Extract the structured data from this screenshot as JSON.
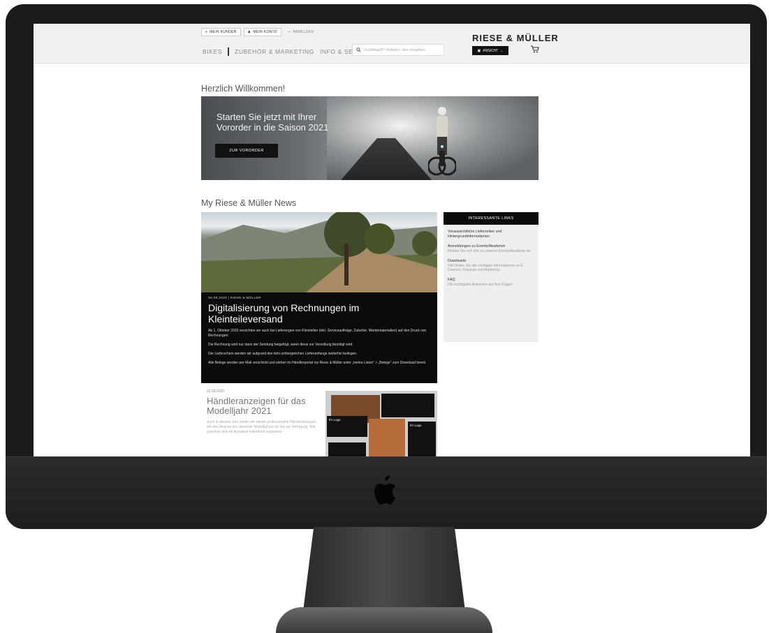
{
  "site": {
    "top_links": [
      "MEIN KUNDEN",
      "MEIN KONTO",
      "ABMELDEN"
    ],
    "brand": "RIESE & MÜLLER",
    "nav": [
      "BIKES",
      "ZUBEHÖR & MARKETING",
      "INFO & SERVICE"
    ],
    "search_placeholder": "Suchbegriff / Artikelnr. hier eingeben",
    "view_label": "ANSICHT",
    "cart_icon": "cart-icon"
  },
  "welcome": "Herzlich Willkommen!",
  "hero": {
    "line1": "Starten Sie jetzt mit Ihrer",
    "line2": "Vororder in die Saison 2021",
    "button": "ZUR VORORDER"
  },
  "news_section_title": "My Riese & Müller News",
  "news": {
    "meta": "30.09.2020 | RIESE & MÜLLER",
    "headline": "Digitalisierung von Rechnungen im Kleinteileversand",
    "p1": "Ab 1. Oktober 2020 verzichten wir auch bei Lieferungen von Kleinteilen (inkl. Serviceaufträge, Zubehör, Werbematerialien) auf den Druck von Rechnungen.",
    "p2": "Die Rechnung wird nur dann der Sendung beigefügt, wenn diese zur Verzollung benötigt wird.",
    "p3": "Der Lieferschein werden wir aufgrund des teils umfangreichen Lieferumfangs weiterhin beilegen.",
    "p4": "Alle Belege werden per Mail verschickt und stehen im Händlerportal my Riese & Müller unter „meine Listen“ > „Belege“ zum Download bereit."
  },
  "links_box": {
    "heading": "INTERESSANTE LINKS",
    "groups": [
      {
        "title": "Voraussichtliche Lieferzeiten und Hintergrundinformationen",
        "desc": ""
      },
      {
        "title": "Anmeldungen zu Events/Akademie",
        "desc": "Melden Sie sich hier zu unseren Events/Akademie an."
      },
      {
        "title": "Downloads",
        "desc": "Hier finden Sie alle wichtigen Informationen zu E-Connect, Kataloge und Marketing."
      },
      {
        "title": "FAQ",
        "desc": "Die wichtigsten Antworten auf Ihre Fragen"
      }
    ]
  },
  "card2": {
    "date": "22.09.2020",
    "title": "Händleranzeigen für das Modelljahr 2021",
    "text": "Auch in diesem Jahr stellen wir wieder professionelle Händleranzeigen mit den Motiven des aktuellen Modelljahres für Sie zur Verfügung. Wie gewohnt sind die Anzeigen individuell anpassbar.",
    "logo_label": "Ihr Logo"
  }
}
